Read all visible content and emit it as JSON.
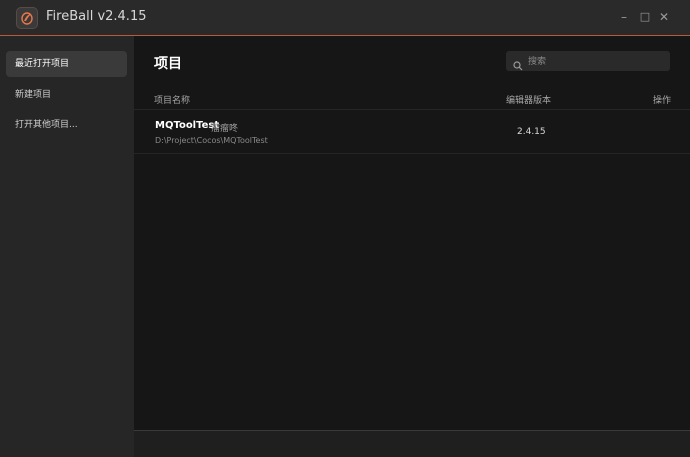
{
  "window": {
    "title": "FireBall v2.4.15",
    "minimize": "–",
    "maximize": "□",
    "close": "✕"
  },
  "sidebar": {
    "items": [
      {
        "label": "最近打开项目",
        "active": true
      },
      {
        "label": "新建项目",
        "active": false
      },
      {
        "label": "打开其他项目..."
      }
    ]
  },
  "main": {
    "title": "项目",
    "search": {
      "placeholder": "搜索",
      "value": ""
    },
    "columns": {
      "name": "项目名称",
      "version": "编辑器版本",
      "actions": "操作"
    },
    "projects": [
      {
        "name": "MQToolTest",
        "owner": "瘤瘤咚",
        "path": "D:\\Project\\Cocos\\MQToolTest",
        "version": "2.4.15"
      }
    ]
  },
  "colors": {
    "accent": "#b85a3f",
    "titlebar_bg": "#2a2a2a",
    "sidebar_bg": "#262626",
    "main_bg": "#161616"
  },
  "icons": {
    "app": "fireball-logo-icon",
    "search": "search-icon"
  }
}
